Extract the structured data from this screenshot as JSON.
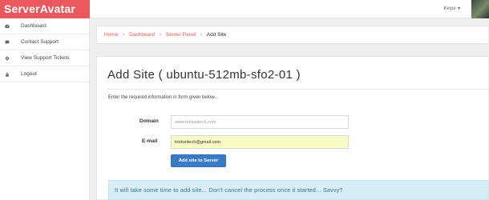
{
  "app": {
    "brand": "ServerAvatar"
  },
  "sidebar": {
    "items": [
      {
        "label": "Dashboard",
        "icon": "dashboard-icon"
      },
      {
        "label": "Contact Support",
        "icon": "chat-icon"
      },
      {
        "label": "View Support Tickets",
        "icon": "ticket-icon"
      },
      {
        "label": "Logout",
        "icon": "lock-icon"
      }
    ]
  },
  "header": {
    "user_name": "Keyur",
    "user_caret": "▾"
  },
  "breadcrumb": {
    "home": "Home",
    "dashboard": "Dashboard",
    "server_panel": "Server Panel",
    "current": "Add Site",
    "separator": "›"
  },
  "main": {
    "title": "Add Site ( ubuntu-512mb-sfo2-01 )",
    "description": "Enter the required information in form given below...",
    "form": {
      "domain_label": "Domain",
      "domain_placeholder": "www.tricksntech.com",
      "email_label": "E-mail",
      "email_value": "tricksntech@gmail.com",
      "submit_label": "Add site to Server"
    },
    "alert": "It will take some time to add site... Don't cancel the process once it started... Savvy?"
  },
  "colors": {
    "brand": "#e8585c",
    "button": "#3a7bc8",
    "alert_bg": "#d9edf7",
    "autofill": "#fafbc4"
  }
}
